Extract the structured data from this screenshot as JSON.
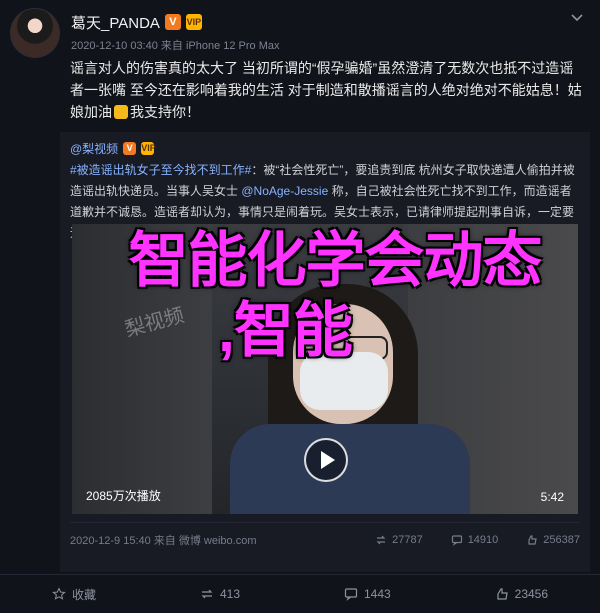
{
  "post": {
    "author": {
      "name": "葛天_PANDA",
      "verified_badge": "V",
      "vip_badge": "VIP"
    },
    "meta": "2020-12-10 03:40 来自 iPhone 12 Pro Max",
    "text": "谣言对人的伤害真的太大了 当初所谓的“假孕骗婚”虽然澄清了无数次也抵不过造谣者一张嘴 至今还在影响着我的生活 对于制造和散播谣言的人绝对绝对不能姑息！姑娘加油",
    "text_end": "我支持你！"
  },
  "repost": {
    "author": "@梨视频",
    "hashtag": "#被造谣出轨女子至今找不到工作#",
    "text": "：被“社会性死亡”，要追责到底 杭州女子取快递遭人偷拍并被造谣出轨快递员。当事人吴女士",
    "mention": "@NoAge-Jessie",
    "text2": "称，自己被社会性死亡找不到工作，而造谣者道歉并不诚恳。造谣者却认为，事情只是闹着玩。吴女士表示，已请律师提起刑事自诉，一定要追责到底",
    "watermark": "梨视频",
    "video": {
      "views": "2085万次播放",
      "duration": "5:42"
    },
    "footer": {
      "date": "2020-12-9 15:40 来自 微博 weibo.com",
      "reposts": "27787",
      "comments": "14910",
      "likes": "256387"
    }
  },
  "overlay": {
    "line1": "智能化学会动态",
    "line2": ",智能"
  },
  "actions": {
    "share": "收藏",
    "repost": "413",
    "comment": "1443",
    "like": "23456"
  }
}
